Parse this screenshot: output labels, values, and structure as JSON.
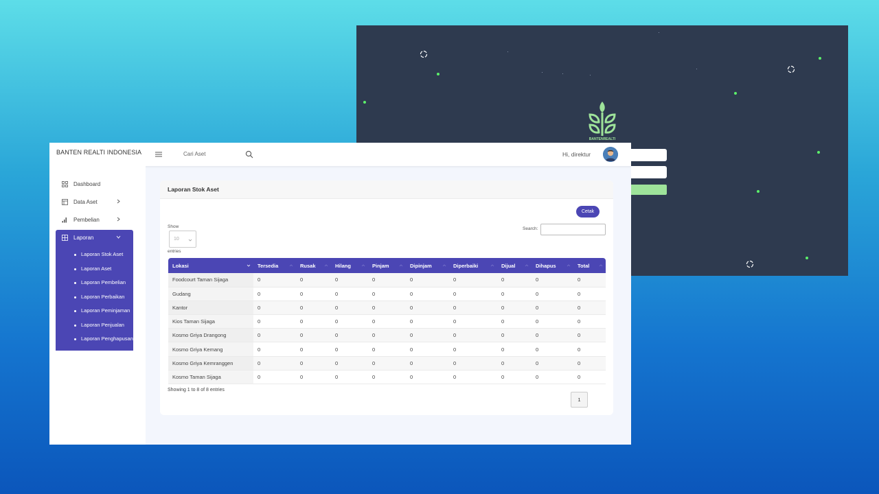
{
  "login": {
    "brand": "BANTENREALTI",
    "colors": {
      "background": "#2e3a4f",
      "dot": "#5cf06a",
      "button": "#9ee39a"
    }
  },
  "app": {
    "brand": "BANTEN REALTI INDONESIA",
    "search_placeholder": "Cari Aset",
    "greeting": "Hi, direktur",
    "accent_color": "#4b46b4"
  },
  "sidebar": {
    "items": [
      {
        "label": "Dashboard",
        "icon": "grid-icon"
      },
      {
        "label": "Data Aset",
        "icon": "layout-icon"
      },
      {
        "label": "Pembelian",
        "icon": "bar-chart-icon"
      }
    ],
    "active": {
      "label": "Laporan",
      "icon": "grid-plus-icon",
      "subitems": [
        "Laporan Stok Aset",
        "Laporan Aset",
        "Laporan Pembelian",
        "Laporan Perbaikan",
        "Laporan Peminjaman",
        "Laporan Penjualan",
        "Laporan Penghapusan"
      ]
    }
  },
  "report": {
    "title": "Laporan Stok Aset",
    "print_label": "Cetak",
    "show_label": "Show",
    "entries_value": "10",
    "entries_label": "entries",
    "search_label": "Search:",
    "columns": [
      "Lokasi",
      "Tersedia",
      "Rusak",
      "Hilang",
      "Pinjam",
      "Dipinjam",
      "Diperbaiki",
      "Dijual",
      "Dihapus",
      "Total"
    ],
    "rows": [
      [
        "Foodcourt Taman Sijaga",
        "0",
        "0",
        "0",
        "0",
        "0",
        "0",
        "0",
        "0",
        "0"
      ],
      [
        "Gudang",
        "0",
        "0",
        "0",
        "0",
        "0",
        "0",
        "0",
        "0",
        "0"
      ],
      [
        "Kantor",
        "0",
        "0",
        "0",
        "0",
        "0",
        "0",
        "0",
        "0",
        "0"
      ],
      [
        "Kios Taman Sijaga",
        "0",
        "0",
        "0",
        "0",
        "0",
        "0",
        "0",
        "0",
        "0"
      ],
      [
        "Kosmo Griya Drangong",
        "0",
        "0",
        "0",
        "0",
        "0",
        "0",
        "0",
        "0",
        "0"
      ],
      [
        "Kosmo Griya Kemang",
        "0",
        "0",
        "0",
        "0",
        "0",
        "0",
        "0",
        "0",
        "0"
      ],
      [
        "Kosmo Griya Kemranggen",
        "0",
        "0",
        "0",
        "0",
        "0",
        "0",
        "0",
        "0",
        "0"
      ],
      [
        "Kosmo Taman Sijaga",
        "0",
        "0",
        "0",
        "0",
        "0",
        "0",
        "0",
        "0",
        "0"
      ]
    ],
    "footer_info": "Showing 1 to 8 of 8 entries",
    "page": "1"
  }
}
